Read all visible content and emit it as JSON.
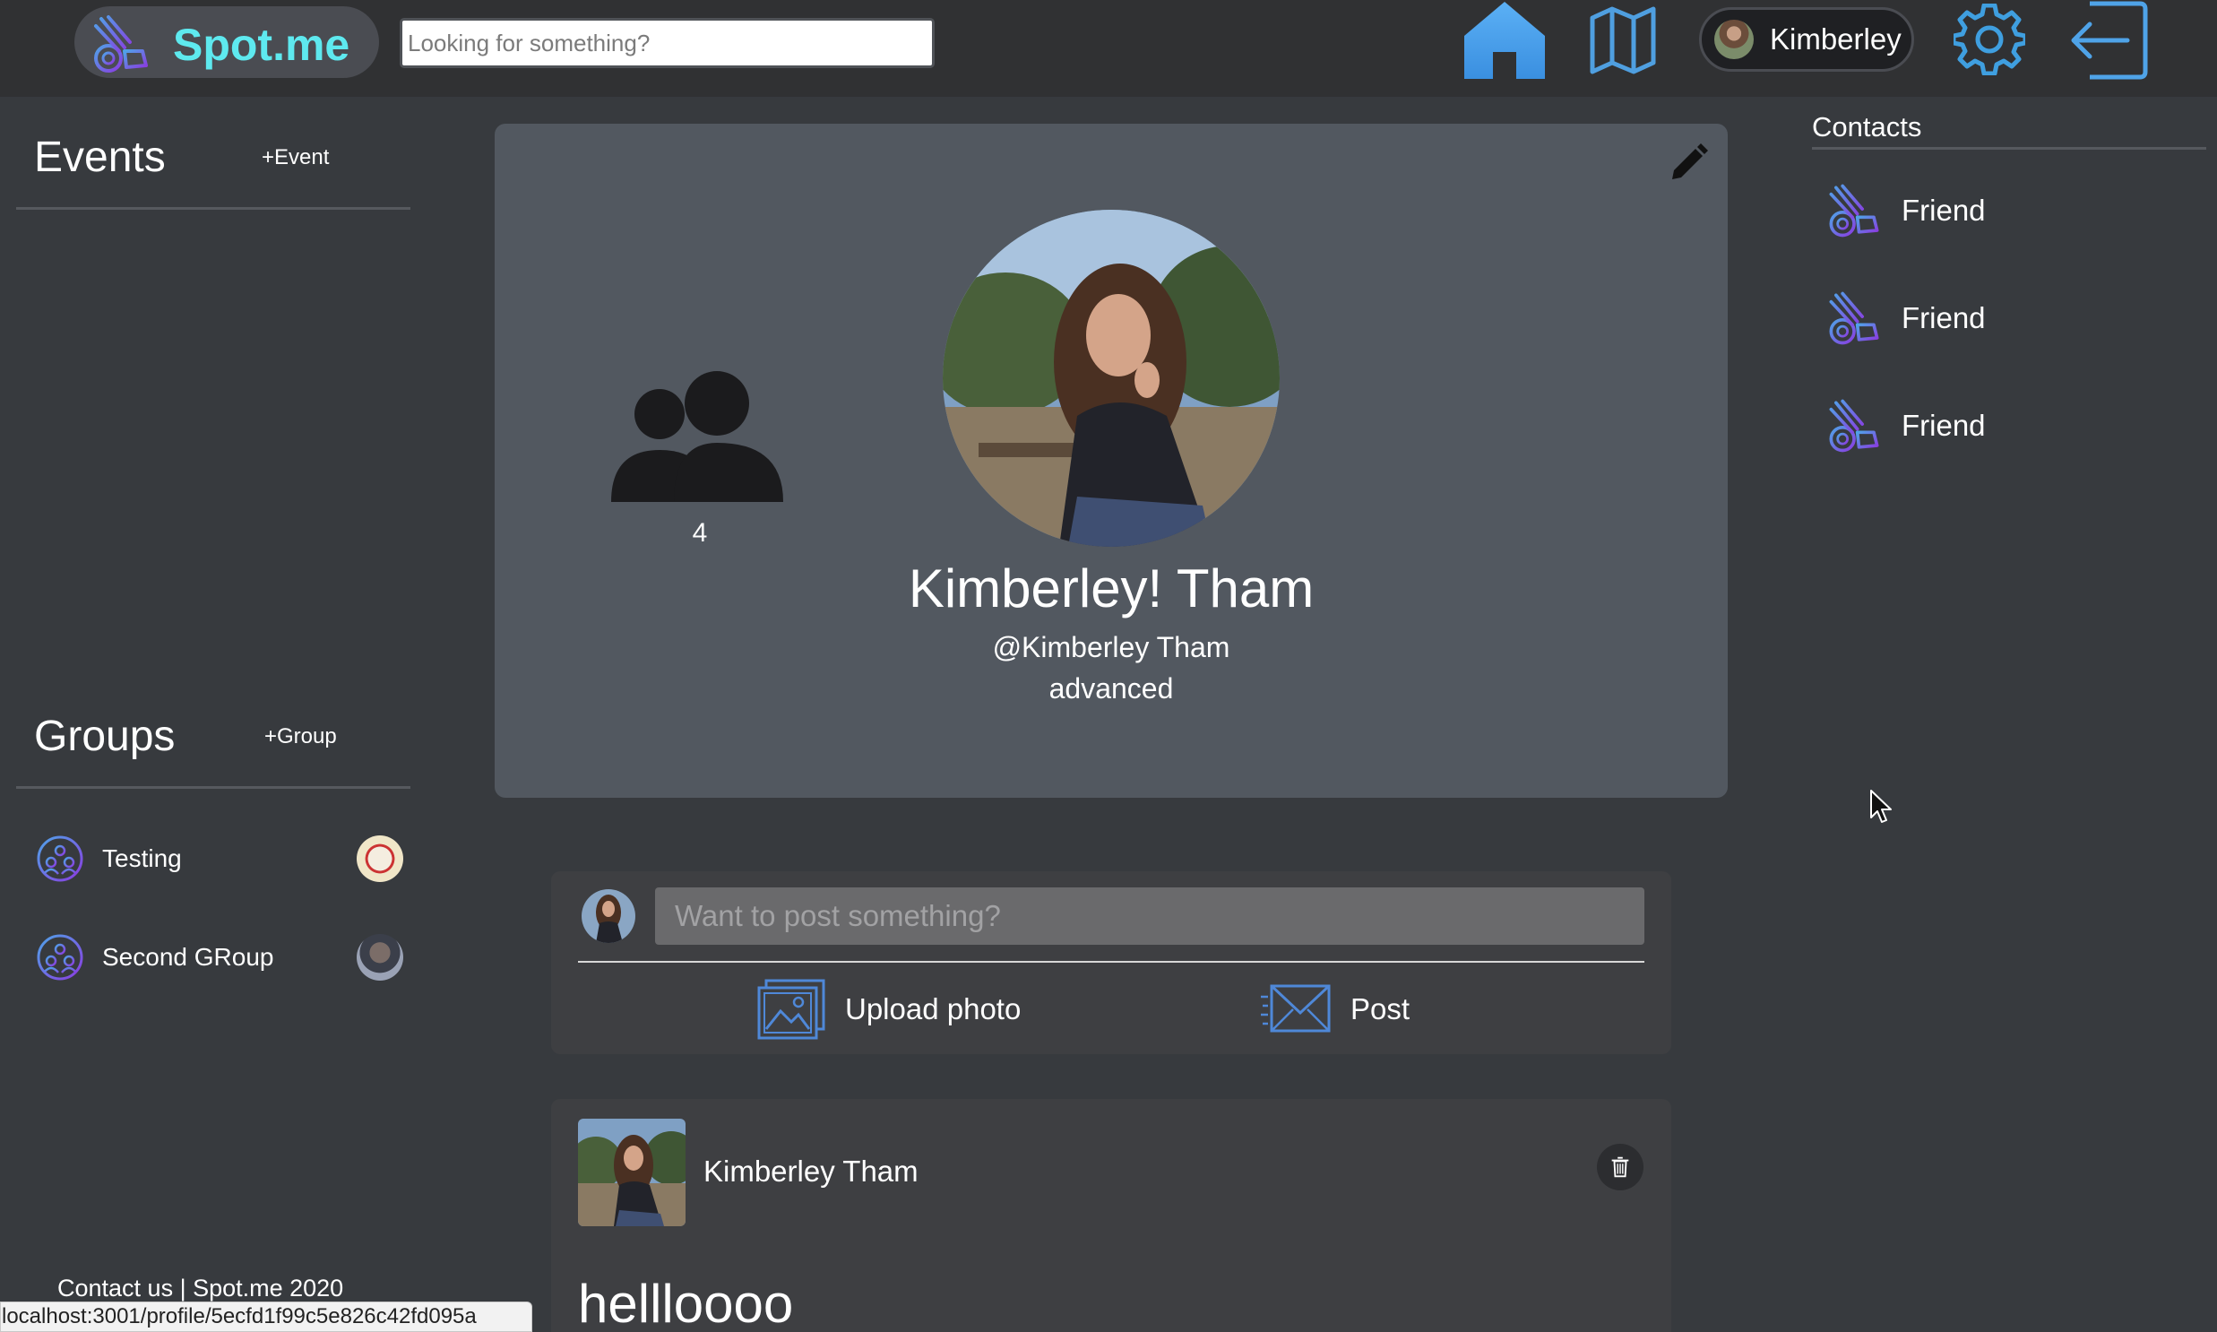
{
  "header": {
    "brand": "Spot.me",
    "search_placeholder": "Looking for something?",
    "user_name": "Kimberley",
    "icons": [
      "home-icon",
      "map-icon",
      "gear-icon",
      "logout-icon"
    ]
  },
  "sidebar": {
    "events_title": "Events",
    "add_event": "+Event",
    "groups_title": "Groups",
    "add_group": "+Group",
    "groups": [
      {
        "name": "Testing"
      },
      {
        "name": "Second GRoup"
      }
    ]
  },
  "profile": {
    "friend_count": "4",
    "name": "Kimberley! Tham",
    "handle": "@Kimberley Tham",
    "level": "advanced"
  },
  "composer": {
    "placeholder": "Want to post something?",
    "upload_label": "Upload photo",
    "post_label": "Post"
  },
  "post": {
    "author": "Kimberley Tham",
    "body": "hellloooo"
  },
  "contacts": {
    "title": "Contacts",
    "items": [
      {
        "name": "Friend"
      },
      {
        "name": "Friend"
      },
      {
        "name": "Friend"
      }
    ]
  },
  "footer": {
    "text": "Contact us | Spot.me 2020"
  },
  "status_bar": {
    "url": "localhost:3001/profile/5ecfd1f99c5e826c42fd095a"
  },
  "colors": {
    "background": "#373a3e",
    "topbar": "#303133",
    "card": "#525860",
    "brand_text": "#5ee9ef",
    "accent_blue": "#4fa3e8",
    "icon_purple": "#6b4fd8"
  }
}
